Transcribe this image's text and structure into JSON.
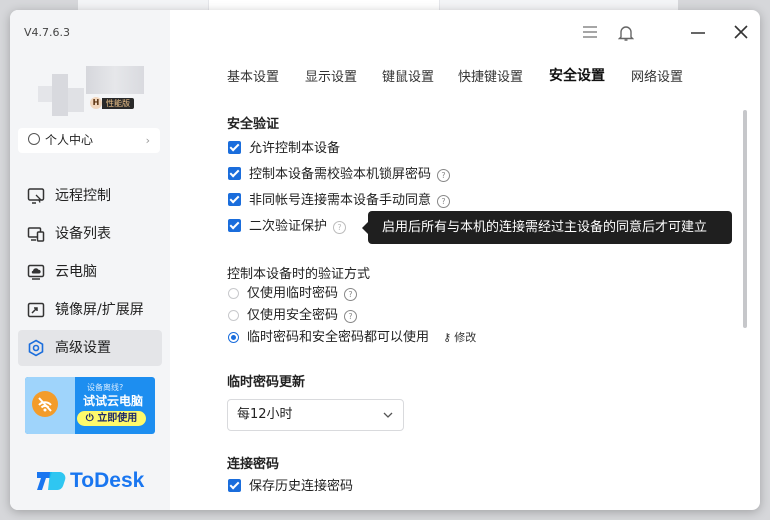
{
  "app": {
    "version": "V4.7.6.3",
    "brand": "ToDesk",
    "accent": "#1a6ddc"
  },
  "user": {
    "badge_letter": "H",
    "edition": "性能版",
    "personal_center": "个人中心"
  },
  "sidebar": {
    "items": [
      {
        "label": "远程控制",
        "icon": "monitor-cursor-icon"
      },
      {
        "label": "设备列表",
        "icon": "devices-icon"
      },
      {
        "label": "云电脑",
        "icon": "cloud-pc-icon"
      },
      {
        "label": "镜像屏/扩展屏",
        "icon": "mirror-screen-icon"
      },
      {
        "label": "高级设置",
        "icon": "hexagon-settings-icon",
        "active": true
      }
    ]
  },
  "promo": {
    "subtitle": "设备离线?",
    "title": "试试云电脑",
    "button": "立即使用"
  },
  "titlebar": {
    "icons": [
      "menu-icon",
      "bell-icon",
      "minimize-icon",
      "close-icon"
    ]
  },
  "tabs": [
    "基本设置",
    "显示设置",
    "键鼠设置",
    "快捷键设置",
    "安全设置",
    "网络设置"
  ],
  "active_tab": "安全设置",
  "security": {
    "title": "安全验证",
    "options": [
      {
        "label": "允许控制本设备",
        "checked": true,
        "help": false
      },
      {
        "label": "控制本设备需校验本机锁屏密码",
        "checked": true,
        "help": true
      },
      {
        "label": "非同帐号连接需本设备手动同意",
        "checked": true,
        "help": true
      },
      {
        "label": "二次验证保护",
        "checked": true,
        "help": true
      }
    ],
    "tooltip": "启用后所有与本机的连接需经过主设备的同意后才可建立"
  },
  "verify_method": {
    "title": "控制本设备时的验证方式",
    "options": [
      {
        "label": "仅使用临时密码",
        "selected": false
      },
      {
        "label": "仅使用安全密码",
        "selected": false
      },
      {
        "label": "临时密码和安全密码都可以使用",
        "selected": true
      }
    ],
    "modify": "修改"
  },
  "temp_password": {
    "title": "临时密码更新",
    "value": "每12小时"
  },
  "connect_password": {
    "title": "连接密码",
    "option": "保存历史连接密码",
    "checked": true
  }
}
